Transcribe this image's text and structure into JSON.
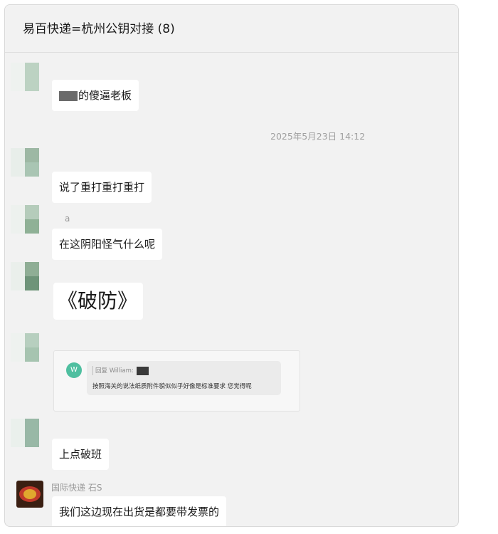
{
  "chat": {
    "title": "易百快递=杭州公钥对接 (8)",
    "timestamp": "2025年5月23日 14:12"
  },
  "messages": [
    {
      "text": "的傻逼老板"
    },
    {
      "text": "说了重打重打重打"
    },
    {
      "sender": "a",
      "text": "在这阴阳怪气什么呢"
    },
    {
      "text": "《破防》"
    },
    {
      "quote": {
        "avatar_letter": "W",
        "reply_label": "回复 William:",
        "text": "按照海关的说法纸质附件貌似似乎好像是标准要求 您觉得呢"
      }
    },
    {
      "text": "上点破班"
    },
    {
      "sender": "国际快递 石S",
      "text": "我们这边现在出货是都要带发票的"
    }
  ],
  "colors": {
    "window_bg": "#f2f2f2",
    "bubble_bg": "#ffffff",
    "meta_text": "#9a9a9a",
    "quote_avatar": "#4fbfa0"
  }
}
